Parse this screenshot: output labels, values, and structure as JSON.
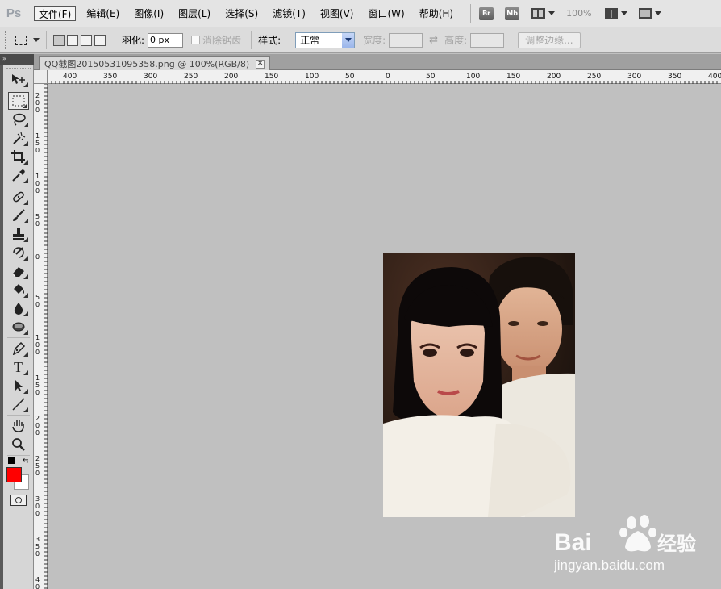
{
  "app": {
    "logo": "Ps"
  },
  "menu": [
    "文件(F)",
    "编辑(E)",
    "图像(I)",
    "图层(L)",
    "选择(S)",
    "滤镜(T)",
    "视图(V)",
    "窗口(W)",
    "帮助(H)"
  ],
  "menubar_right": {
    "br_label": "Br",
    "mb_label": "Mb",
    "zoom": "100%"
  },
  "options": {
    "feather_label": "羽化:",
    "feather_value": "0 px",
    "antialias_label": "消除锯齿",
    "style_label": "样式:",
    "style_value": "正常",
    "width_label": "宽度:",
    "height_label": "高度:",
    "refine_label": "调整边缘..."
  },
  "document": {
    "tab_title": "QQ截图20150531095358.png @ 100%(RGB/8)",
    "close_glyph": "✕"
  },
  "rulers": {
    "horizontal": [
      "400",
      "350",
      "300",
      "250",
      "200",
      "150",
      "100",
      "50",
      "0",
      "50",
      "100",
      "150",
      "200",
      "250",
      "300",
      "350",
      "400"
    ],
    "vertical": [
      "200",
      "150",
      "100",
      "50",
      "0",
      "50",
      "100",
      "150",
      "200",
      "250",
      "300",
      "350",
      "400"
    ]
  },
  "toolbar": {
    "foreground_color": "#ff0000",
    "background_color": "#ffffff",
    "tools": [
      "move-tool",
      "rect-marquee-tool",
      "lasso-tool",
      "quick-select-tool",
      "crop-tool",
      "eyedropper-tool",
      "healing-brush-tool",
      "brush-tool",
      "clone-stamp-tool",
      "history-brush-tool",
      "eraser-tool",
      "paint-bucket-tool",
      "blur-tool",
      "dodge-tool",
      "pen-tool",
      "type-tool",
      "path-select-tool",
      "line-tool",
      "hand-tool",
      "zoom-tool"
    ],
    "type_glyph": "T"
  },
  "watermark": {
    "brand": "Bai",
    "brand_suffix": "经验",
    "url": "jingyan.baidu.com"
  }
}
